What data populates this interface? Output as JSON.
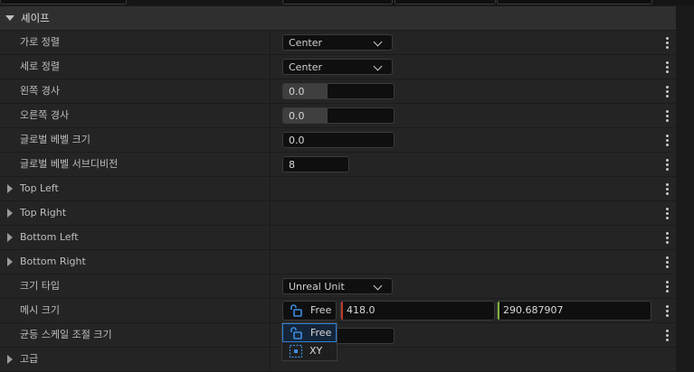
{
  "section": {
    "title": "셰이프"
  },
  "rows": [
    {
      "label": "가로 정렬",
      "value": "Center"
    },
    {
      "label": "세로 정렬",
      "value": "Center"
    },
    {
      "label": "왼쪽 경사",
      "value": "0.0",
      "slider_fraction": 0.4
    },
    {
      "label": "오른쪽 경사",
      "value": "0.0",
      "slider_fraction": 0.4
    },
    {
      "label": "글로벌 베벨 크기",
      "value": "0.0"
    },
    {
      "label": "글로벌 베벨 서브디비전",
      "value": "8"
    },
    {
      "label": "Top Left"
    },
    {
      "label": "Top Right"
    },
    {
      "label": "Bottom Left"
    },
    {
      "label": "Bottom Right"
    },
    {
      "label": "크기 타입",
      "value": "Unreal Unit"
    },
    {
      "label": "메시 크기",
      "lock_mode": "Free",
      "x": "418.0",
      "y": "290.687907"
    },
    {
      "label": "균등 스케일 조절 크기"
    },
    {
      "label": "고급"
    }
  ],
  "dropdown": {
    "options": [
      "Free",
      "XY"
    ],
    "selected": "Free"
  },
  "colors": {
    "x_axis": "#c0392b",
    "y_axis": "#7fb33a",
    "highlight": "#2f7fd6"
  }
}
